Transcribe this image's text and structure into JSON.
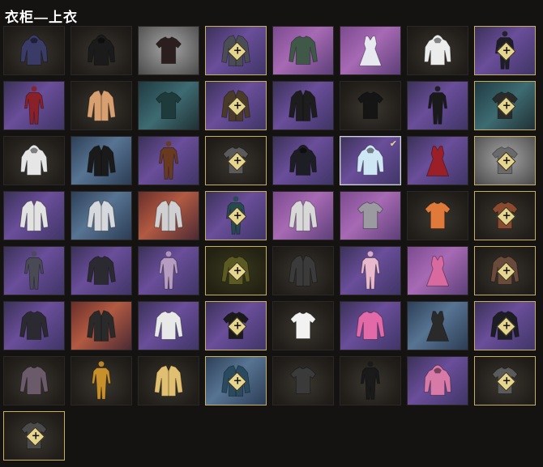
{
  "header": {
    "title": "衣柜—上衣"
  },
  "colors": {
    "lock_accent": "#e6d58e",
    "selected_border": "#cfd4d8"
  },
  "items": [
    {
      "name": "hooded-jacket",
      "bg": "dark",
      "shape": "hoodie",
      "color": "#3a3b66",
      "locked": false
    },
    {
      "name": "black-hoodie",
      "bg": "dark",
      "shape": "hoodie",
      "color": "#1b1b1b",
      "locked": false
    },
    {
      "name": "red-print-tshirt",
      "bg": "gray",
      "shape": "tshirt",
      "color": "#2a1e1e",
      "locked": false
    },
    {
      "name": "locked-jacket",
      "bg": "purple",
      "shape": "jacket",
      "color": "#4a4d54",
      "locked": true
    },
    {
      "name": "green-longsleeve",
      "bg": "pink",
      "shape": "longsleeve",
      "color": "#3f5848",
      "locked": false
    },
    {
      "name": "white-dress-top",
      "bg": "pink",
      "shape": "dress",
      "color": "#e8e8f0",
      "locked": false
    },
    {
      "name": "white-hoodie",
      "bg": "dark",
      "shape": "hoodie",
      "color": "#ececec",
      "locked": false
    },
    {
      "name": "locked-dark-outfit",
      "bg": "purple",
      "shape": "suit",
      "color": "#1e1e26",
      "locked": true
    },
    {
      "name": "red-jumpsuit",
      "bg": "purple",
      "shape": "suit",
      "color": "#8a2028",
      "locked": false
    },
    {
      "name": "orange-white-jacket",
      "bg": "dark",
      "shape": "jacket",
      "color": "#d8a070",
      "locked": false
    },
    {
      "name": "teal-tshirt",
      "bg": "teal",
      "shape": "tshirt",
      "color": "#1f3a3a",
      "locked": false
    },
    {
      "name": "locked-camo-coat",
      "bg": "purple",
      "shape": "jacket",
      "color": "#4a3a2a",
      "locked": true
    },
    {
      "name": "gold-sash-vest",
      "bg": "purple",
      "shape": "jacket",
      "color": "#1d1d1d",
      "locked": false
    },
    {
      "name": "black-yellow-tee",
      "bg": "dark",
      "shape": "tshirt",
      "color": "#151515",
      "locked": false
    },
    {
      "name": "black-bodysuit",
      "bg": "purple",
      "shape": "suit",
      "color": "#1a1a1a",
      "locked": false
    },
    {
      "name": "locked-dark-shirt",
      "bg": "teal",
      "shape": "tshirt",
      "color": "#2a2a2a",
      "locked": true
    },
    {
      "name": "white-black-hoodie",
      "bg": "dark",
      "shape": "hoodie",
      "color": "#e6e6e6",
      "locked": false
    },
    {
      "name": "black-vest",
      "bg": "blue",
      "shape": "jacket",
      "color": "#1a1a1a",
      "locked": false
    },
    {
      "name": "brown-coverall",
      "bg": "purple",
      "shape": "suit",
      "color": "#6a3a20",
      "locked": false
    },
    {
      "name": "locked-gray-shirt",
      "bg": "dark",
      "shape": "tshirt",
      "color": "#5a5a5a",
      "locked": true
    },
    {
      "name": "black-cloak",
      "bg": "purple",
      "shape": "hoodie",
      "color": "#1d1d24",
      "locked": false
    },
    {
      "name": "icy-hoodie",
      "bg": "purple",
      "shape": "hoodie",
      "color": "#cfe6f5",
      "locked": false,
      "selected": true
    },
    {
      "name": "red-dress",
      "bg": "purple",
      "shape": "dress",
      "color": "#9a1f26",
      "locked": false
    },
    {
      "name": "locked-top",
      "bg": "gray",
      "shape": "tshirt",
      "color": "#6a6a6a",
      "locked": true
    },
    {
      "name": "white-biker-jacket",
      "bg": "purple",
      "shape": "jacket",
      "color": "#e2e2e2",
      "locked": false
    },
    {
      "name": "white-armor-jacket",
      "bg": "blue",
      "shape": "jacket",
      "color": "#d5d8dc",
      "locked": false
    },
    {
      "name": "mech-jacket",
      "bg": "orange",
      "shape": "jacket",
      "color": "#d0cfd2",
      "locked": false
    },
    {
      "name": "locked-teal-top",
      "bg": "purple",
      "shape": "suit",
      "color": "#254a50",
      "locked": true
    },
    {
      "name": "white-black-jacket",
      "bg": "pink",
      "shape": "jacket",
      "color": "#d8d8d8",
      "locked": false
    },
    {
      "name": "gray-crop-top",
      "bg": "pink",
      "shape": "tshirt",
      "color": "#9a9aa0",
      "locked": false
    },
    {
      "name": "orange-tee",
      "bg": "dark",
      "shape": "tshirt",
      "color": "#e07a3a",
      "locked": false
    },
    {
      "name": "locked-brown-tee",
      "bg": "dark",
      "shape": "tshirt",
      "color": "#8a4a30",
      "locked": true
    },
    {
      "name": "gray-suit",
      "bg": "purple",
      "shape": "suit",
      "color": "#4a4a55",
      "locked": false
    },
    {
      "name": "tattoo-tee",
      "bg": "purple",
      "shape": "longsleeve",
      "color": "#2a2a30",
      "locked": false
    },
    {
      "name": "pink-jumpsuit",
      "bg": "purple",
      "shape": "suit",
      "color": "#b59cc0",
      "locked": false
    },
    {
      "name": "locked-olive-sweater",
      "bg": "olive",
      "shape": "longsleeve",
      "color": "#5a5a22",
      "locked": true
    },
    {
      "name": "red-lined-jacket",
      "bg": "dark",
      "shape": "jacket",
      "color": "#3a3a3a",
      "locked": false
    },
    {
      "name": "pink-bodysuit",
      "bg": "purple",
      "shape": "suit",
      "color": "#e8b8cc",
      "locked": false
    },
    {
      "name": "pink-crop-top",
      "bg": "pink",
      "shape": "dress",
      "color": "#d86aa0",
      "locked": false
    },
    {
      "name": "locked-brown-sweater",
      "bg": "dark",
      "shape": "longsleeve",
      "color": "#6a4a3a",
      "locked": true
    },
    {
      "name": "graffiti-sweater",
      "bg": "purple",
      "shape": "longsleeve",
      "color": "#2a2a30",
      "locked": false
    },
    {
      "name": "red-black-jacket",
      "bg": "orange",
      "shape": "jacket",
      "color": "#2a2a2a",
      "locked": false
    },
    {
      "name": "white-blouse",
      "bg": "purple",
      "shape": "longsleeve",
      "color": "#e8e8e8",
      "locked": false
    },
    {
      "name": "locked-black-tee",
      "bg": "purple",
      "shape": "tshirt",
      "color": "#1a1a1a",
      "locked": true
    },
    {
      "name": "duck-print-tee",
      "bg": "dark",
      "shape": "tshirt",
      "color": "#f2f2f2",
      "locked": false
    },
    {
      "name": "pink-sweatshirt",
      "bg": "purple",
      "shape": "longsleeve",
      "color": "#e26aa8",
      "locked": false
    },
    {
      "name": "gray-harness-top",
      "bg": "blue",
      "shape": "dress",
      "color": "#2a2a2a",
      "locked": false
    },
    {
      "name": "locked-black-jacket",
      "bg": "purple",
      "shape": "longsleeve",
      "color": "#1d1d24",
      "locked": true
    },
    {
      "name": "plaid-shirt",
      "bg": "dark",
      "shape": "longsleeve",
      "color": "#6a5a6a",
      "locked": false
    },
    {
      "name": "yellow-coverall",
      "bg": "dark",
      "shape": "suit",
      "color": "#c8902a",
      "locked": false
    },
    {
      "name": "yellow-black-jacket",
      "bg": "dark",
      "shape": "jacket",
      "color": "#e0c070",
      "locked": false
    },
    {
      "name": "locked-blue-jacket",
      "bg": "blue",
      "shape": "jacket",
      "color": "#2a4a60",
      "locked": true
    },
    {
      "name": "graphic-tee",
      "bg": "dark",
      "shape": "tshirt",
      "color": "#3a3a3a",
      "locked": false
    },
    {
      "name": "black-coat",
      "bg": "dark",
      "shape": "suit",
      "color": "#1a1a1a",
      "locked": false
    },
    {
      "name": "pink-hoodie",
      "bg": "purple",
      "shape": "hoodie",
      "color": "#d87aa8",
      "locked": false
    },
    {
      "name": "locked-gray-tee",
      "bg": "dark",
      "shape": "tshirt",
      "color": "#5a5a5a",
      "locked": true
    },
    {
      "name": "locked-dark-tee",
      "bg": "dark",
      "shape": "tshirt",
      "color": "#4a4a4a",
      "locked": true
    }
  ]
}
